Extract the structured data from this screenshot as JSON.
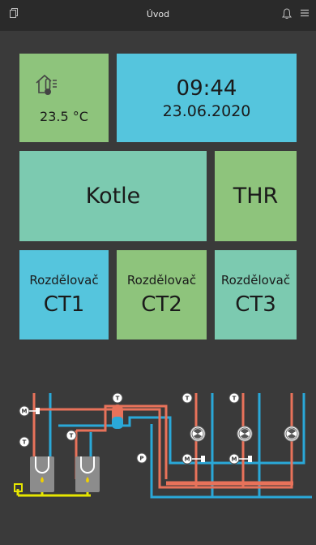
{
  "header": {
    "title": "Úvod",
    "left_icon": "copy-icon",
    "right_icons": [
      "bell-icon",
      "menu-icon"
    ]
  },
  "tiles": {
    "temperature": {
      "value": "23.5 °C",
      "icon": "thermometer-home-icon",
      "color": "#8ec47c"
    },
    "clock": {
      "time": "09:44",
      "date": "23.06.2020",
      "color": "#55c5dd"
    },
    "kotle": {
      "label": "Kotle",
      "color": "#7ccab0"
    },
    "thr": {
      "label": "THR",
      "color": "#8ec47c"
    },
    "distributors": [
      {
        "label": "Rozdělovač",
        "number": "CT1",
        "color": "#55c5dd"
      },
      {
        "label": "Rozdělovač",
        "number": "CT2",
        "color": "#8ec47c"
      },
      {
        "label": "Rozdělovač",
        "number": "CT3",
        "color": "#7ccab0"
      }
    ]
  },
  "diagram": {
    "colors": {
      "hot": "#e8725a",
      "cold": "#2aa8d8",
      "gas": "#e6e600",
      "device": "#8c8c8c"
    },
    "sensor_labels": [
      "M",
      "T",
      "P"
    ]
  }
}
